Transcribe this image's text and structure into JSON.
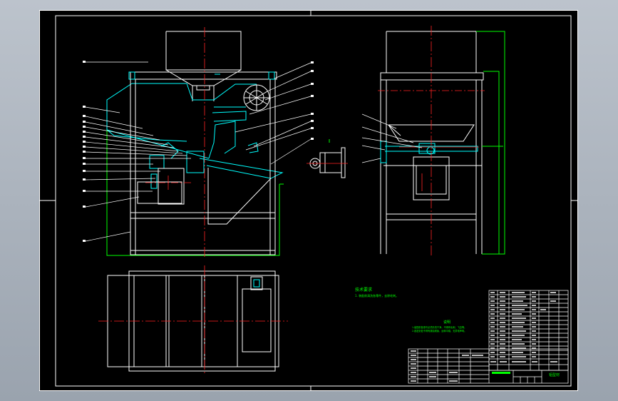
{
  "colors": {
    "background": "#000000",
    "border": "#ffffff",
    "centerline": "#ff2020",
    "dimension": "#00ff00",
    "section": "#00ffff",
    "note_text": "#00ff00",
    "workspace": "#a5adb8"
  },
  "notes": {
    "left_title": "技术要求",
    "left_line": "1. 装配前清洗各零件，去除毛刺。",
    "center_title": "说明",
    "center_line1": "1.装配前各零件必须清洗干净，不得有毛刺、飞边等。",
    "center_line2": "2.各密封处不得有漏油现象，运转平稳，无异常声响。"
  },
  "title_block": {
    "drawing_name": "铝型材"
  }
}
